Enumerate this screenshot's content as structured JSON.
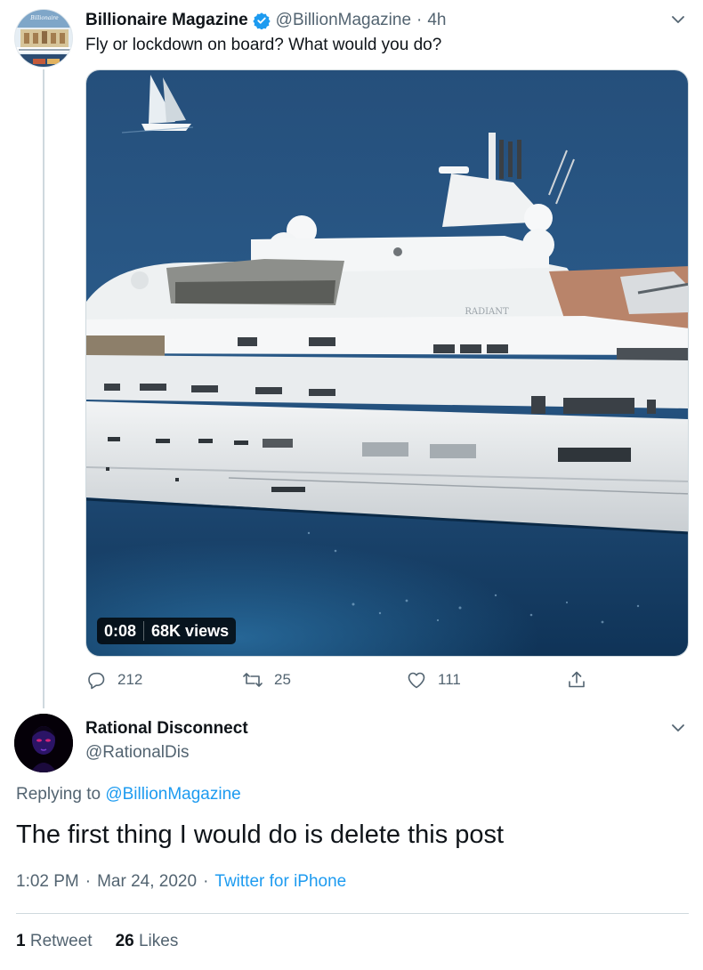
{
  "tweet": {
    "author_name": "Billionaire Magazine",
    "author_handle": "@BillionMagazine",
    "separator": "·",
    "time": "4h",
    "text": "Fly or lockdown on board? What would you do?",
    "video": {
      "duration": "0:08",
      "views": "68K views",
      "hull_name": "RADIANT"
    },
    "actions": {
      "replies": "212",
      "retweets": "25",
      "likes": "111"
    },
    "icons": {
      "verified": "verified-badge-icon",
      "more": "chevron-down-icon",
      "reply": "reply-icon",
      "retweet": "retweet-icon",
      "like": "heart-icon",
      "share": "share-icon"
    }
  },
  "reply": {
    "author_name": "Rational Disconnect",
    "author_handle": "@RationalDis",
    "replying_prefix": "Replying to",
    "replying_to": "@BillionMagazine",
    "text": "The first thing I would do is delete this post",
    "time": "1:02 PM",
    "separator": "·",
    "date": "Mar 24, 2020",
    "source": "Twitter for iPhone",
    "retweet_count": "1",
    "retweet_label": "Retweet",
    "like_count": "26",
    "like_label": "Likes"
  },
  "colors": {
    "accent": "#1d9bf0",
    "muted": "#536471",
    "text": "#0f1419",
    "sea": "#1f4f7f"
  }
}
